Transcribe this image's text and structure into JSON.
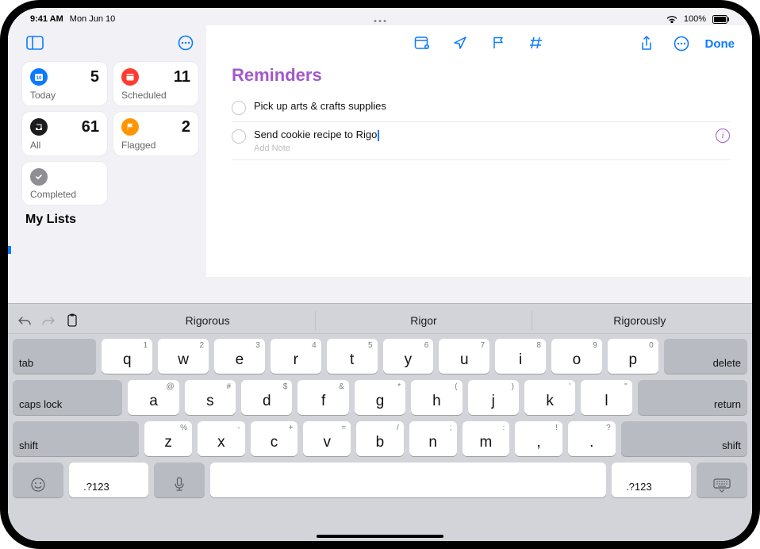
{
  "statusbar": {
    "time": "9:41 AM",
    "date": "Mon Jun 10",
    "battery": "100%",
    "wifi_icon": "wifi",
    "battery_icon": "battery"
  },
  "sidebar": {
    "view_toggle_icon": "sidebar-toggle",
    "more_icon": "ellipsis-circle",
    "cards": [
      {
        "id": "today",
        "label": "Today",
        "count": "5",
        "icon": "calendar-today"
      },
      {
        "id": "scheduled",
        "label": "Scheduled",
        "count": "11",
        "icon": "calendar"
      },
      {
        "id": "all",
        "label": "All",
        "count": "61",
        "icon": "tray"
      },
      {
        "id": "flagged",
        "label": "Flagged",
        "count": "2",
        "icon": "flag"
      },
      {
        "id": "completed",
        "label": "Completed",
        "count": "",
        "icon": "checkmark"
      }
    ],
    "mylists_heading": "My Lists"
  },
  "main": {
    "title": "Reminders",
    "toolbar": {
      "details_icon": "calendar-badge",
      "location_icon": "location-arrow",
      "flag_icon": "flag-outline",
      "tag_icon": "number-sign",
      "share_icon": "share",
      "more_icon": "ellipsis-circle",
      "done_label": "Done"
    },
    "reminders": [
      {
        "title": "Pick up arts & crafts supplies",
        "editing": false
      },
      {
        "title": "Send cookie recipe to Rigo",
        "editing": true,
        "note_placeholder": "Add Note"
      }
    ]
  },
  "keyboard": {
    "tools": {
      "undo": "undo",
      "redo": "redo",
      "paste": "clipboard"
    },
    "suggestions": [
      "Rigorous",
      "Rigor",
      "Rigorously"
    ],
    "row1": [
      {
        "main": "q",
        "sub": "1"
      },
      {
        "main": "w",
        "sub": "2"
      },
      {
        "main": "e",
        "sub": "3"
      },
      {
        "main": "r",
        "sub": "4"
      },
      {
        "main": "t",
        "sub": "5"
      },
      {
        "main": "y",
        "sub": "6"
      },
      {
        "main": "u",
        "sub": "7"
      },
      {
        "main": "i",
        "sub": "8"
      },
      {
        "main": "o",
        "sub": "9"
      },
      {
        "main": "p",
        "sub": "0"
      }
    ],
    "row2": [
      {
        "main": "a",
        "sub": "@"
      },
      {
        "main": "s",
        "sub": "#"
      },
      {
        "main": "d",
        "sub": "$"
      },
      {
        "main": "f",
        "sub": "&"
      },
      {
        "main": "g",
        "sub": "*"
      },
      {
        "main": "h",
        "sub": "("
      },
      {
        "main": "j",
        "sub": ")"
      },
      {
        "main": "k",
        "sub": "'"
      },
      {
        "main": "l",
        "sub": "\""
      }
    ],
    "row3": [
      {
        "main": "z",
        "sub": "%"
      },
      {
        "main": "x",
        "sub": "-"
      },
      {
        "main": "c",
        "sub": "+"
      },
      {
        "main": "v",
        "sub": "="
      },
      {
        "main": "b",
        "sub": "/"
      },
      {
        "main": "n",
        "sub": ";"
      },
      {
        "main": "m",
        "sub": ":"
      },
      {
        "main": ",",
        "sub": "!"
      },
      {
        "main": ".",
        "sub": "?"
      }
    ],
    "fn": {
      "tab": "tab",
      "delete": "delete",
      "caps": "caps lock",
      "return": "return",
      "shift": "shift",
      "emoji": "emoji",
      "numsym": ".?123",
      "mic": "mic",
      "dismiss": "dismiss-keyboard"
    }
  }
}
